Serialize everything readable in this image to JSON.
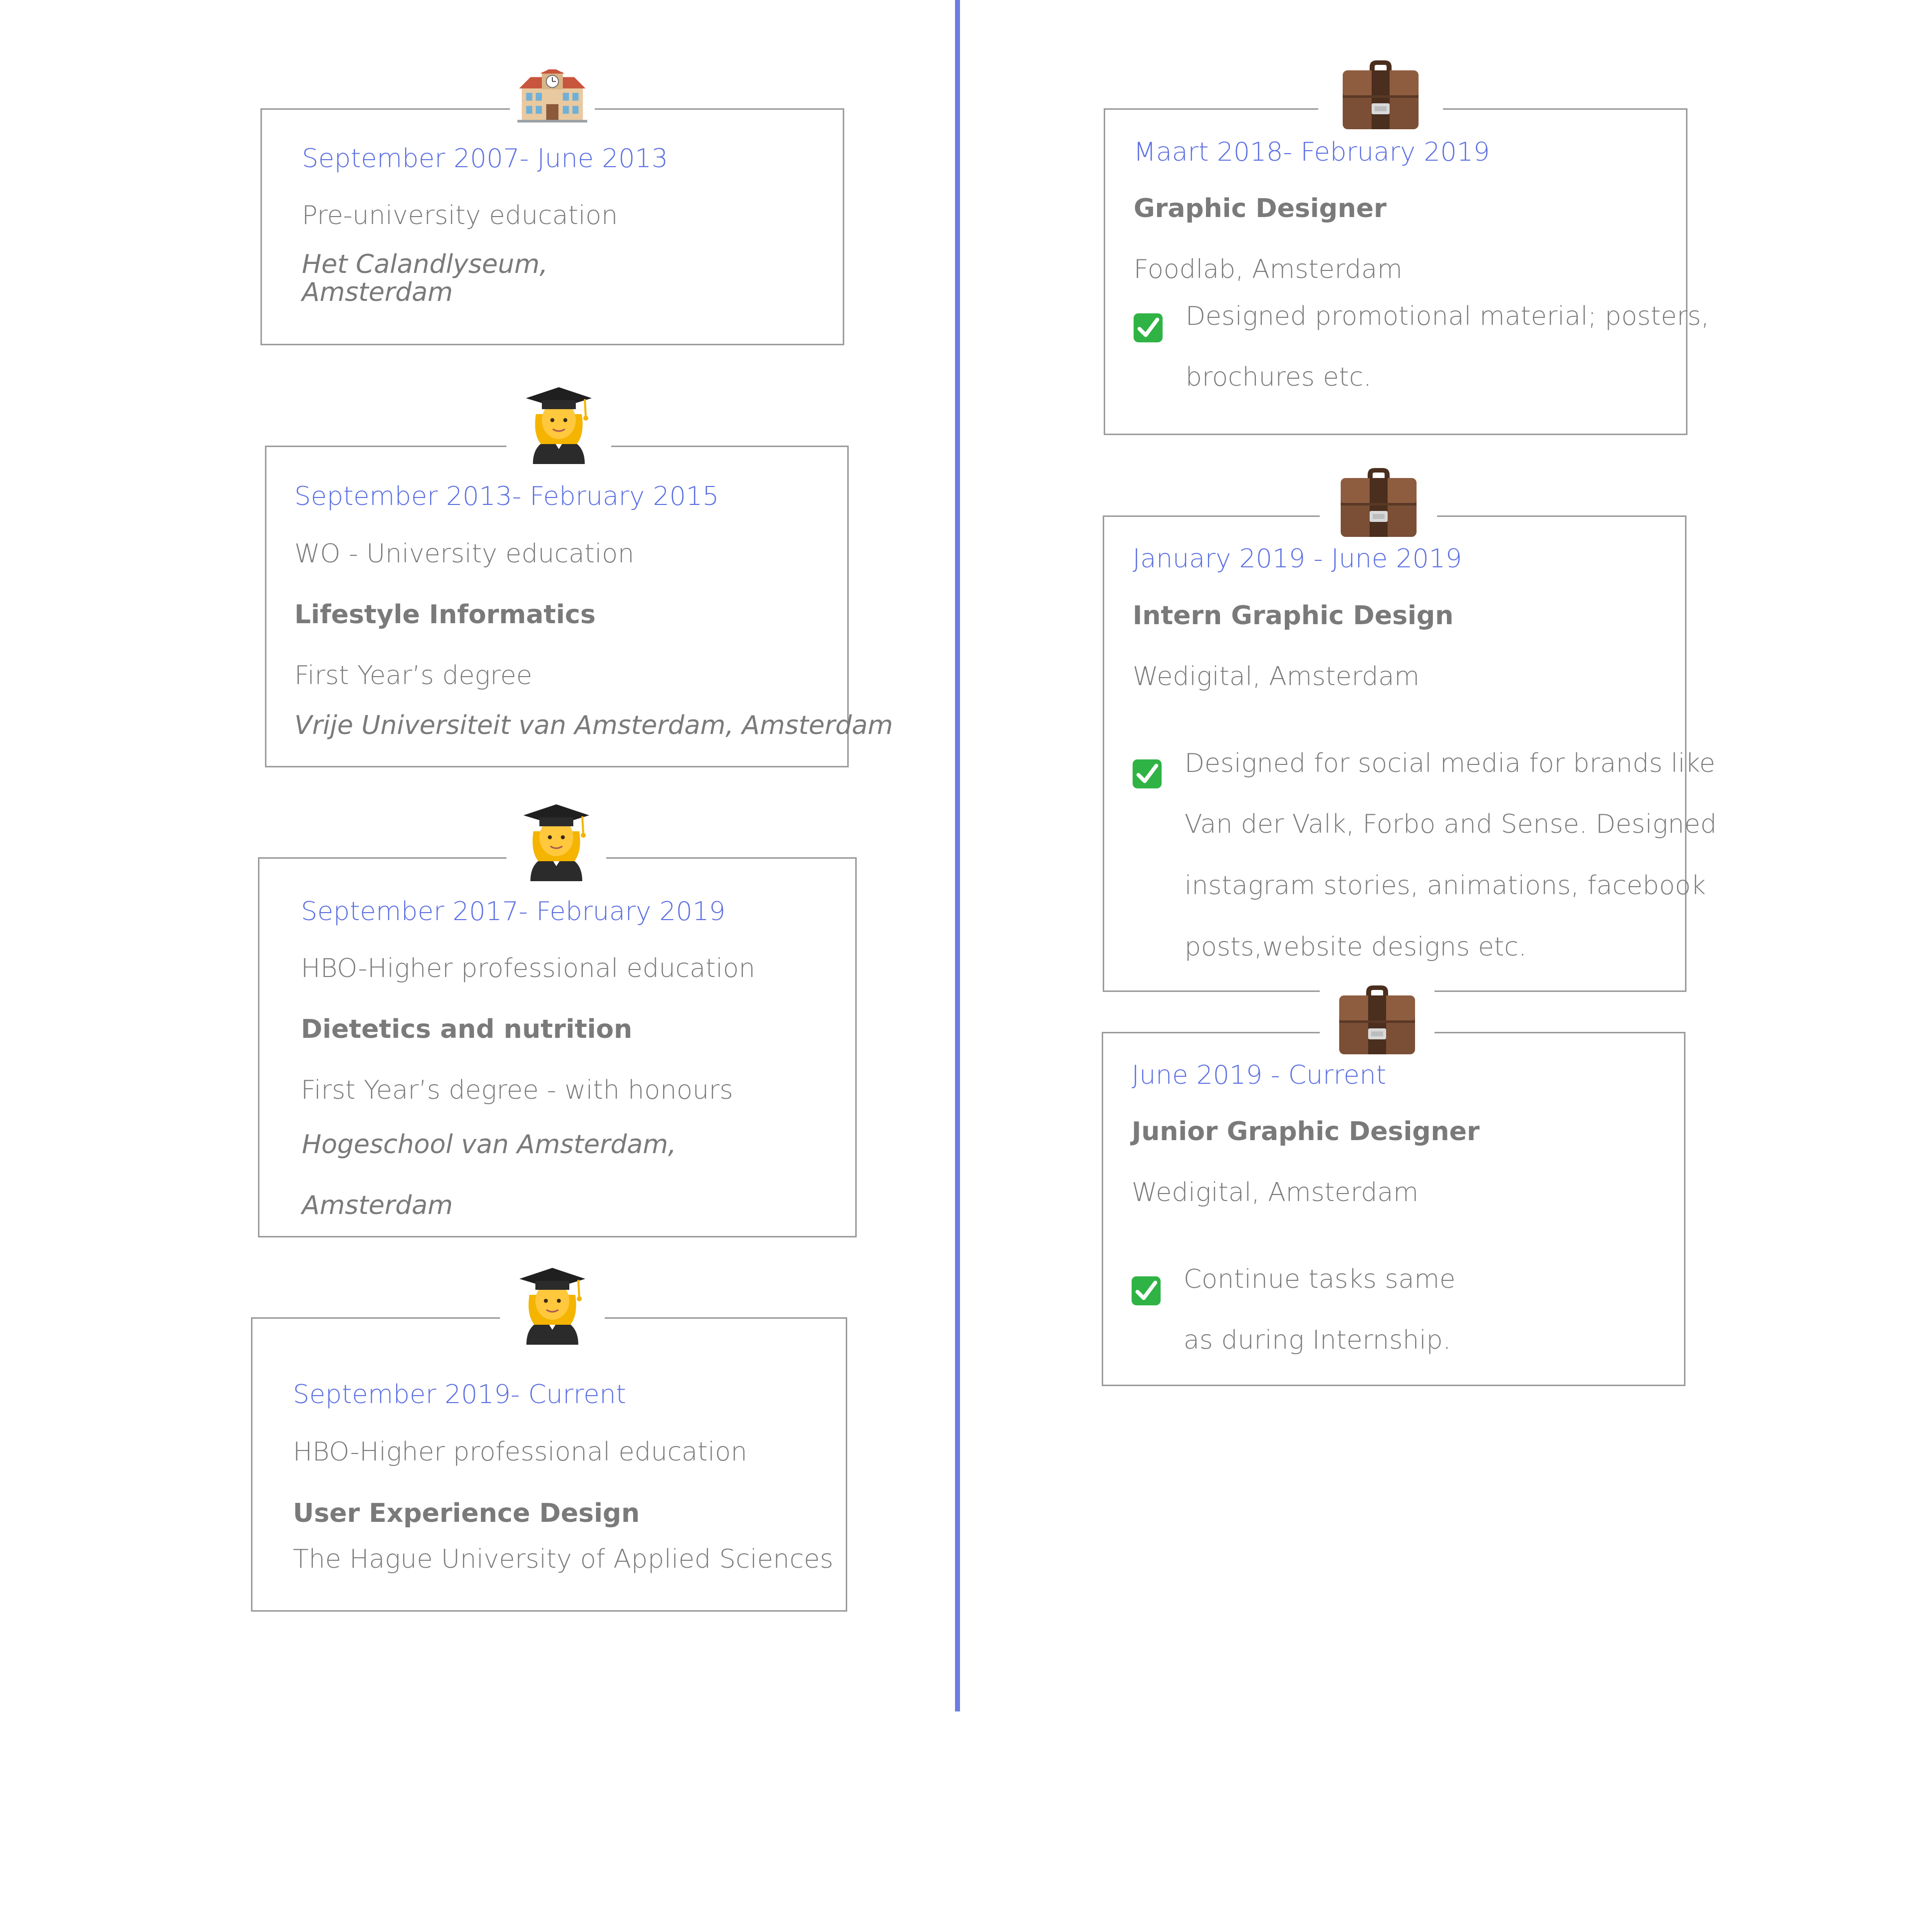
{
  "education": [
    {
      "icon": "school-icon",
      "date": "September 2007- June 2013",
      "level": "Pre-university education",
      "school_line1": "Het Calandlyseum,",
      "school_line2": "Amsterdam"
    },
    {
      "icon": "graduate-icon",
      "date": "September 2013- February 2015",
      "level": "WO - University education",
      "program": "Lifestyle Informatics",
      "degree": "First Year’s degree",
      "school": "Vrije Universiteit van Amsterdam, Amsterdam"
    },
    {
      "icon": "graduate-icon",
      "date": "September 2017- February 2019",
      "level": "HBO-Higher professional education",
      "program": "Dietetics and nutrition",
      "degree": "First Year’s degree - with honours",
      "school_line1": "Hogeschool van Amsterdam,",
      "school_line2": "Amsterdam"
    },
    {
      "icon": "graduate-icon",
      "date": "September 2019- Current",
      "level": "HBO-Higher professional education",
      "program": "User Experience Design",
      "school": "The Hague University of Applied Sciences"
    }
  ],
  "work": [
    {
      "icon": "briefcase-icon",
      "date": "Maart 2018- February 2019",
      "role": "Graphic Designer",
      "company": "Foodlab, Amsterdam",
      "task_lines": [
        "Designed promotional material; posters,",
        "brochures etc."
      ]
    },
    {
      "icon": "briefcase-icon",
      "date": "January 2019 - June 2019",
      "role": "Intern Graphic Design",
      "company": "Wedigital, Amsterdam",
      "task_lines": [
        "Designed for social media for brands like",
        "Van der Valk, Forbo and Sense. Designed",
        "instagram stories, animations, facebook",
        "posts,website designs etc."
      ]
    },
    {
      "icon": "briefcase-icon",
      "date": "June 2019 - Current",
      "role": "Junior Graphic Designer",
      "company": "Wedigital, Amsterdam",
      "task_lines": [
        "Continue tasks same",
        "as during Internship."
      ]
    }
  ],
  "colors": {
    "accent": "#5b6fe2",
    "divider": "#6c7ee1",
    "text": "#7a7a7a",
    "border": "#9c9c9c",
    "check": "#2fb344"
  }
}
